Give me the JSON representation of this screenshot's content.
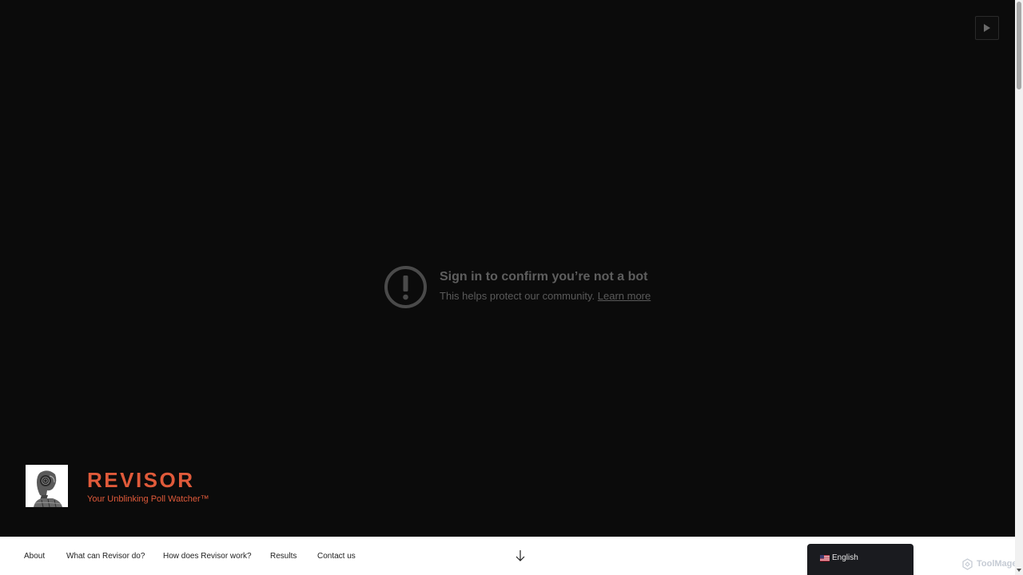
{
  "video": {
    "play_icon": "play-icon",
    "notice": {
      "icon": "exclamation-circle-icon",
      "title": "Sign in to confirm you’re not a bot",
      "text": "This helps protect our community.",
      "link": "Learn more"
    }
  },
  "site": {
    "title": "REVISOR",
    "tagline": "Your Unblinking Poll Watcher™",
    "accent_color": "#e05a3a",
    "logo_icon": "robot-profile-logo"
  },
  "nav": {
    "items": [
      {
        "label": "About"
      },
      {
        "label": "What can Revisor do?"
      },
      {
        "label": "How does Revisor work?"
      },
      {
        "label": "Results"
      },
      {
        "label": "Contact us"
      }
    ],
    "scroll_icon": "arrow-down-icon"
  },
  "language": {
    "label": "English",
    "flag_icon": "us-flag-icon"
  },
  "watermark": {
    "text": "ToolMage",
    "icon": "toolmage-logo-icon"
  }
}
